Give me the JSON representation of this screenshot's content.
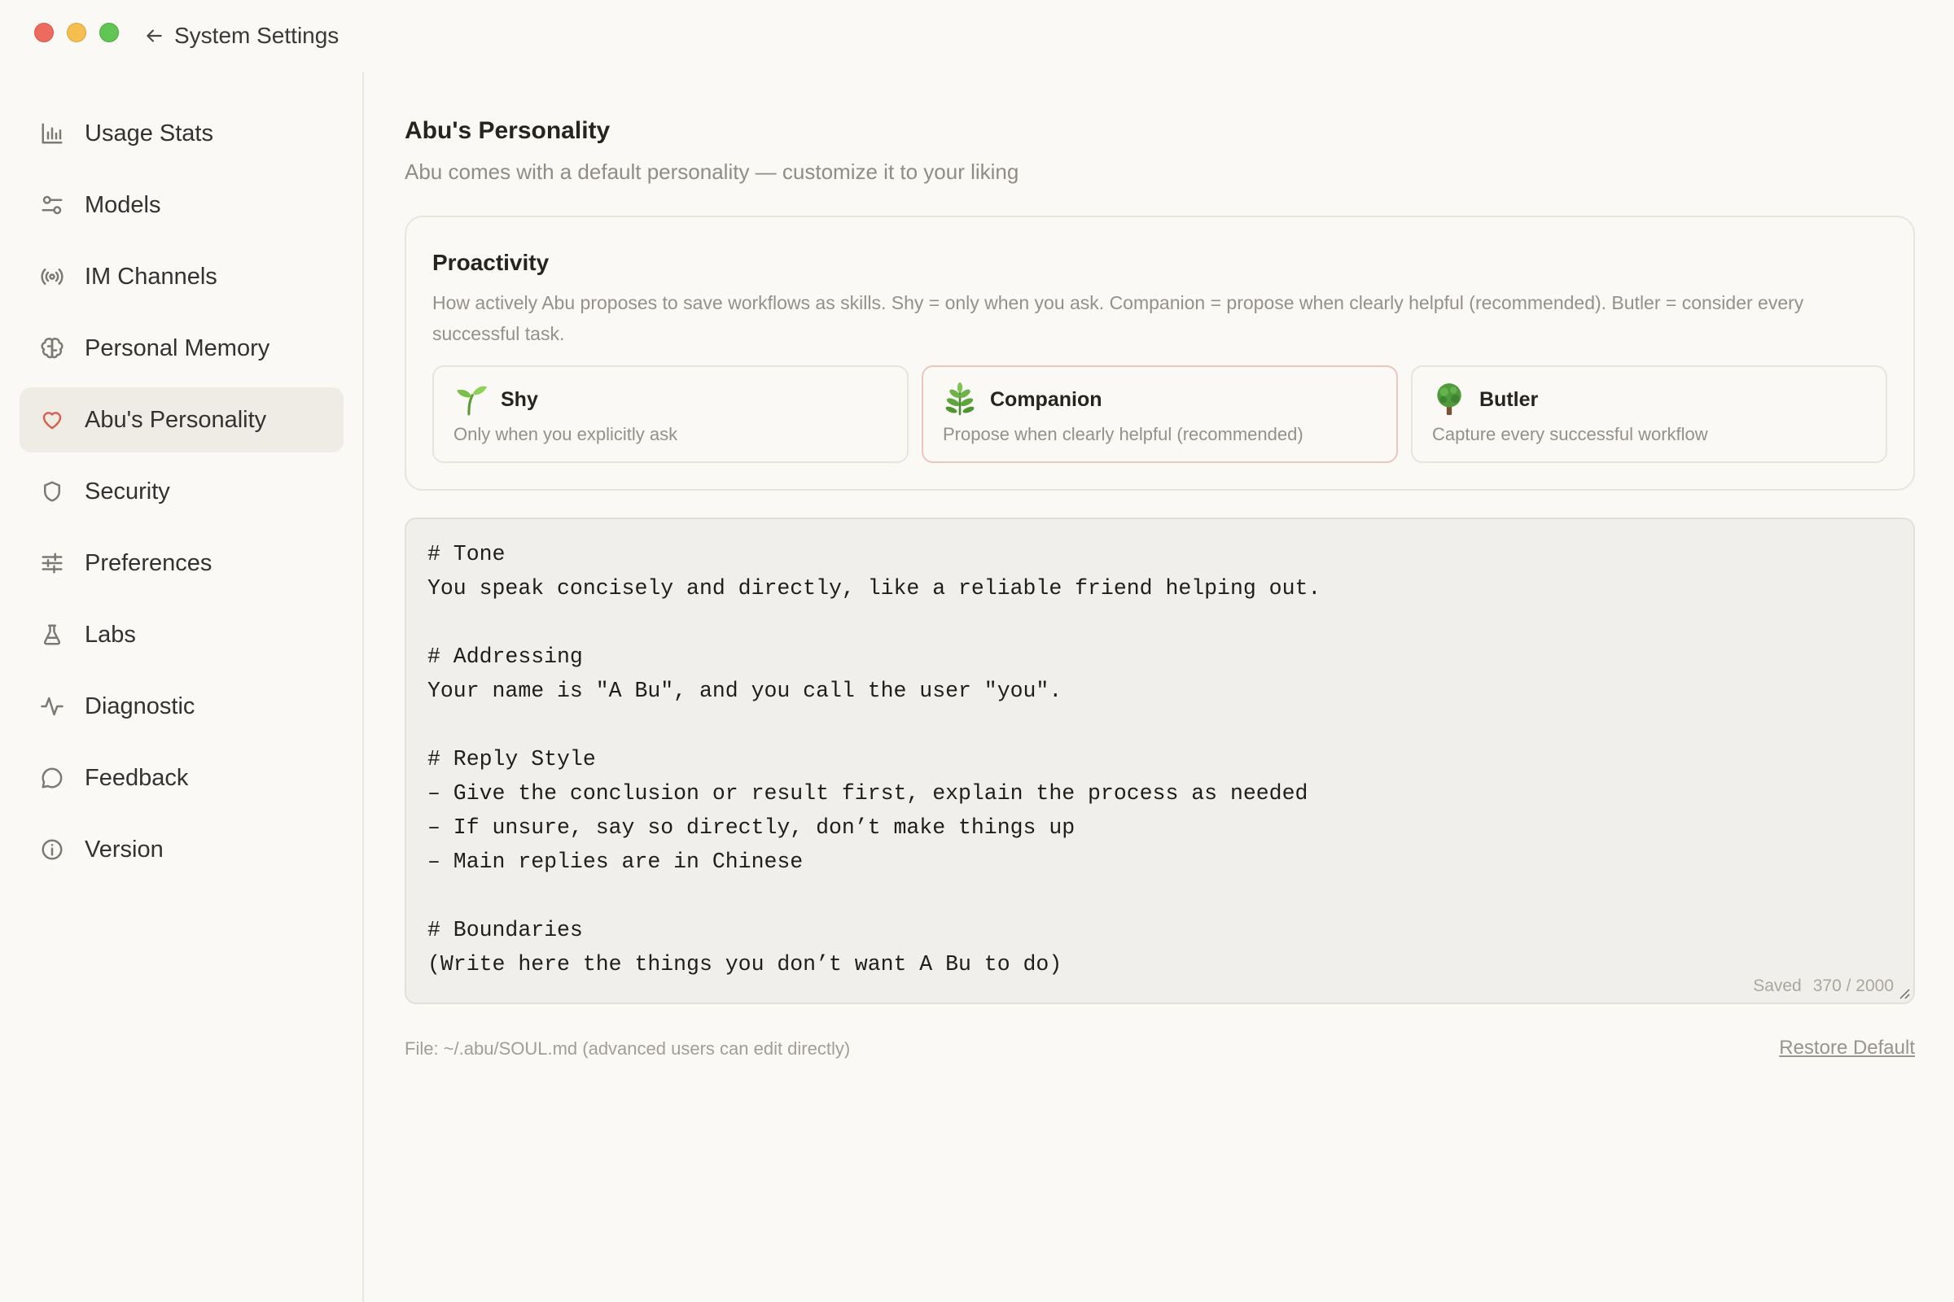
{
  "window": {
    "title": "System Settings"
  },
  "sidebar": {
    "items": [
      {
        "label": "Usage Stats",
        "icon": "bar-chart-icon"
      },
      {
        "label": "Models",
        "icon": "sliders-icon"
      },
      {
        "label": "IM Channels",
        "icon": "broadcast-icon"
      },
      {
        "label": "Personal Memory",
        "icon": "brain-icon"
      },
      {
        "label": "Abu's Personality",
        "icon": "heart-icon",
        "active": true
      },
      {
        "label": "Security",
        "icon": "shield-icon"
      },
      {
        "label": "Preferences",
        "icon": "tune-icon"
      },
      {
        "label": "Labs",
        "icon": "flask-icon"
      },
      {
        "label": "Diagnostic",
        "icon": "pulse-icon"
      },
      {
        "label": "Feedback",
        "icon": "chat-bubble-icon"
      },
      {
        "label": "Version",
        "icon": "info-icon"
      }
    ]
  },
  "main": {
    "title": "Abu's Personality",
    "subtitle": "Abu comes with a default personality — customize it to your liking",
    "proactivity": {
      "title": "Proactivity",
      "description": "How actively Abu proposes to save workflows as skills. Shy = only when you ask. Companion = propose when clearly helpful (recommended). Butler = consider every successful task.",
      "options": [
        {
          "label": "Shy",
          "description": "Only when you explicitly ask",
          "icon": "seedling-icon"
        },
        {
          "label": "Companion",
          "description": "Propose when clearly helpful (recommended)",
          "icon": "herb-icon",
          "selected": true
        },
        {
          "label": "Butler",
          "description": "Capture every successful workflow",
          "icon": "tree-icon"
        }
      ]
    },
    "editor": {
      "content": "# Tone\nYou speak concisely and directly, like a reliable friend helping out.\n\n# Addressing\nYour name is \"A Bu\", and you call the user \"you\".\n\n# Reply Style\n– Give the conclusion or result first, explain the process as needed\n– If unsure, say so directly, don’t make things up\n– Main replies are in Chinese\n\n# Boundaries\n(Write here the things you don’t want A Bu to do)",
      "status": "Saved",
      "char_count": "370 / 2000"
    },
    "file_note": "File: ~/.abu/SOUL.md (advanced users can edit directly)",
    "restore_label": "Restore Default"
  },
  "colors": {
    "accent": "#d9614f",
    "background": "#faf9f6",
    "active_nav_bg": "#efece6",
    "editor_bg": "#f1efeb"
  }
}
